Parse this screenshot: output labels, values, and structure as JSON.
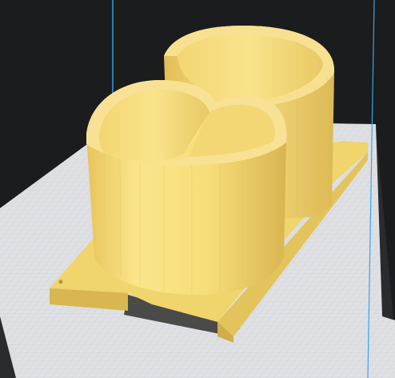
{
  "viewport": {
    "background_color": "#1b1c1e",
    "build_plate_color": "#dedfe3",
    "grid_color": "#c2c5cc",
    "model_color": "#f5dc78",
    "model_shadow_color": "#c9a946",
    "axis_line_color": "#3aa3e8"
  },
  "scene": {
    "object": "double-ring-holder",
    "rings": 2
  }
}
